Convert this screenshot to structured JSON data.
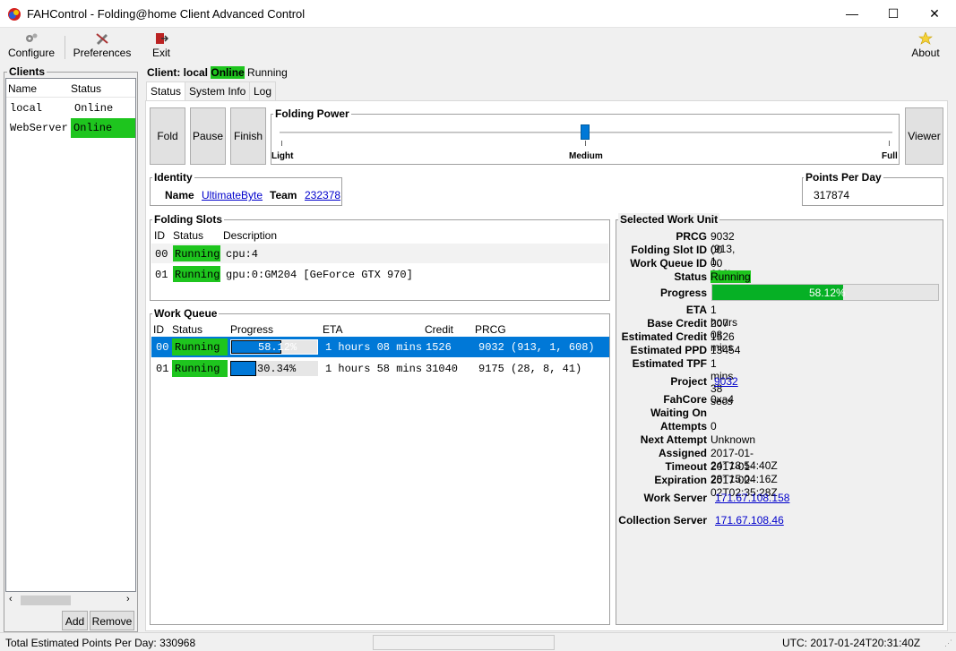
{
  "window": {
    "title": "FAHControl - Folding@home Client Advanced Control",
    "minimize": "—",
    "maximize": "☐",
    "close": "✕"
  },
  "toolbar": {
    "configure": "Configure",
    "preferences": "Preferences",
    "exit": "Exit",
    "about": "About"
  },
  "clients": {
    "title": "Clients",
    "col_name": "Name",
    "col_status": "Status",
    "rows": [
      {
        "name": "local",
        "status": "Online"
      },
      {
        "name": "WebServer",
        "status": "Online"
      }
    ],
    "add": "Add",
    "remove": "Remove"
  },
  "header": {
    "prefix": "Client: local",
    "online": "Online",
    "running": "Running"
  },
  "tabs": [
    "Status",
    "System Info",
    "Log"
  ],
  "controls": {
    "fold": "Fold",
    "pause": "Pause",
    "finish": "Finish",
    "viewer": "Viewer"
  },
  "folding_power": {
    "title": "Folding Power",
    "light": "Light",
    "medium": "Medium",
    "full": "Full",
    "level": 0.5
  },
  "identity": {
    "title": "Identity",
    "name_label": "Name",
    "name": "UltimateByte",
    "team_label": "Team",
    "team": "232378"
  },
  "ppd": {
    "title": "Points Per Day",
    "value": "317874"
  },
  "slots": {
    "title": "Folding Slots",
    "col_id": "ID",
    "col_status": "Status",
    "col_desc": "Description",
    "rows": [
      {
        "id": "00",
        "status": "Running",
        "desc": "cpu:4"
      },
      {
        "id": "01",
        "status": "Running",
        "desc": "gpu:0:GM204 [GeForce GTX 970]"
      }
    ]
  },
  "queue": {
    "title": "Work Queue",
    "cols": {
      "id": "ID",
      "status": "Status",
      "progress": "Progress",
      "eta": "ETA",
      "credit": "Credit",
      "prcg": "PRCG"
    },
    "rows": [
      {
        "id": "00",
        "status": "Running",
        "progress": "58.12%",
        "pct": 0.5812,
        "eta": "1 hours 08 mins",
        "credit": "1526",
        "prcg": "9032 (913, 1, 608)"
      },
      {
        "id": "01",
        "status": "Running",
        "progress": "30.34%",
        "pct": 0.3034,
        "eta": "1 hours 58 mins",
        "credit": "31040",
        "prcg": "9175 (28, 8, 41)"
      }
    ]
  },
  "work_unit": {
    "title": "Selected Work Unit",
    "prcg_label": "PRCG",
    "prcg": "9032 (913, 1, 608)",
    "slot_label": "Folding Slot ID",
    "slot": "00",
    "queue_label": "Work Queue ID",
    "queue": "00",
    "status_label": "Status",
    "status": "Running",
    "progress_label": "Progress",
    "progress": "58.12%",
    "progress_pct": 0.5812,
    "eta_label": "ETA",
    "eta": "1 hours 08 mins",
    "base_label": "Base Credit",
    "base": "207",
    "est_label": "Estimated Credit",
    "est": "1526",
    "eppd_label": "Estimated PPD",
    "eppd": "13454",
    "etpf_label": "Estimated TPF",
    "etpf": "1 mins 38 secs",
    "project_label": "Project",
    "project": "9032",
    "core_label": "FahCore",
    "core": "0xa4",
    "waiting_label": "Waiting On",
    "waiting": "",
    "attempts_label": "Attempts",
    "attempts": "0",
    "next_label": "Next Attempt",
    "next": "Unknown",
    "assigned_label": "Assigned",
    "assigned": "2017-01-24T18:54:40Z",
    "timeout_label": "Timeout",
    "timeout": "2017-01-28T15:04:16Z",
    "expiration_label": "Expiration",
    "expiration": "2017-02-02T02:35:28Z",
    "ws_label": "Work Server",
    "ws": "171.67.108.158",
    "cs_label": "Collection Server",
    "cs": "171.67.108.46"
  },
  "statusbar": {
    "total": "Total Estimated Points Per Day: 330968",
    "utc": "UTC: 2017-01-24T20:31:40Z"
  },
  "colors": {
    "online": "#1ec51e",
    "selection": "#0078d7",
    "progress_fill": "#06b025"
  }
}
